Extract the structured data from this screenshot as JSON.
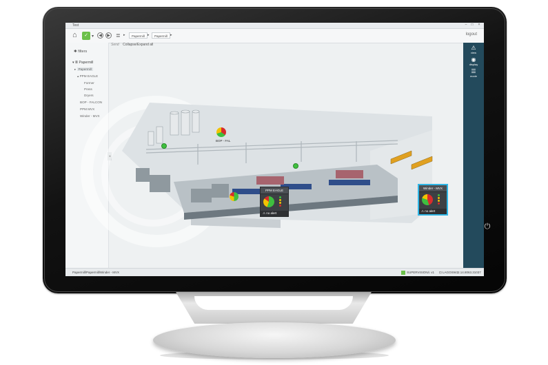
{
  "window": {
    "title": "Test"
  },
  "toolbar": {
    "crumbs": [
      "Papermill",
      "Papermill"
    ],
    "logout": "logout"
  },
  "left_panel": {
    "filters_label": "filters",
    "tree": {
      "root": "Papermill",
      "selected": "Papermill",
      "items": [
        "PPM EAGLE",
        "Former",
        "Press",
        "Dryers",
        "BOP - FALCON",
        "PPM MVX",
        "Winder - MVX"
      ]
    }
  },
  "subbar": {
    "send": "Send",
    "collapse": "Collapse/Expand all"
  },
  "right_panel": {
    "items": [
      {
        "icon": "warning-icon",
        "label": "view"
      },
      {
        "icon": "display-icon",
        "label": "display"
      },
      {
        "icon": "mode-icon",
        "label": "mode"
      }
    ]
  },
  "plant": {
    "bop_label": "BOP - FAL",
    "ppm_popup": {
      "title": "PPM EAGLE",
      "footer": "no alert"
    },
    "winder_popup": {
      "title": "Winder - MVX",
      "footer": "no alert"
    }
  },
  "statusbar": {
    "path": "Papermill/Papermill/Winder - MVX",
    "user": "SUPERVISION",
    "user2": "v1",
    "host": "LAGOS941",
    "version": "2.14.8063.31037"
  },
  "colors": {
    "accent_green": "#6cc04a",
    "panel_teal": "#234a5c",
    "highlight_cyan": "#2fb6e6"
  }
}
